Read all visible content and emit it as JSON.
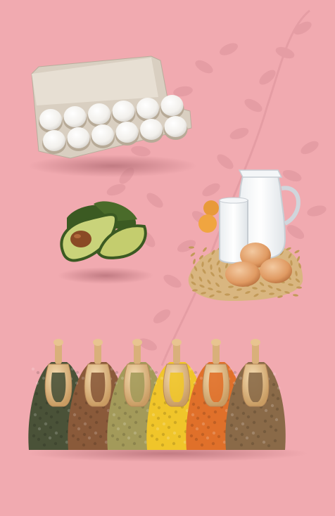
{
  "scene": {
    "background_color": "#f1aab0",
    "shadow_color": "#c98088",
    "leaf_pattern_color": "#dd949c",
    "items": [
      {
        "name": "egg-carton",
        "egg_count": 12
      },
      {
        "name": "avocado"
      },
      {
        "name": "milk-eggs-grain"
      },
      {
        "name": "lentil-scoops",
        "scoop_count": 6
      }
    ],
    "lentil_colors": [
      "#4a5238",
      "#8a5a3a",
      "#a39a5a",
      "#f0c52a",
      "#e0702a",
      "#8a6a48"
    ]
  }
}
